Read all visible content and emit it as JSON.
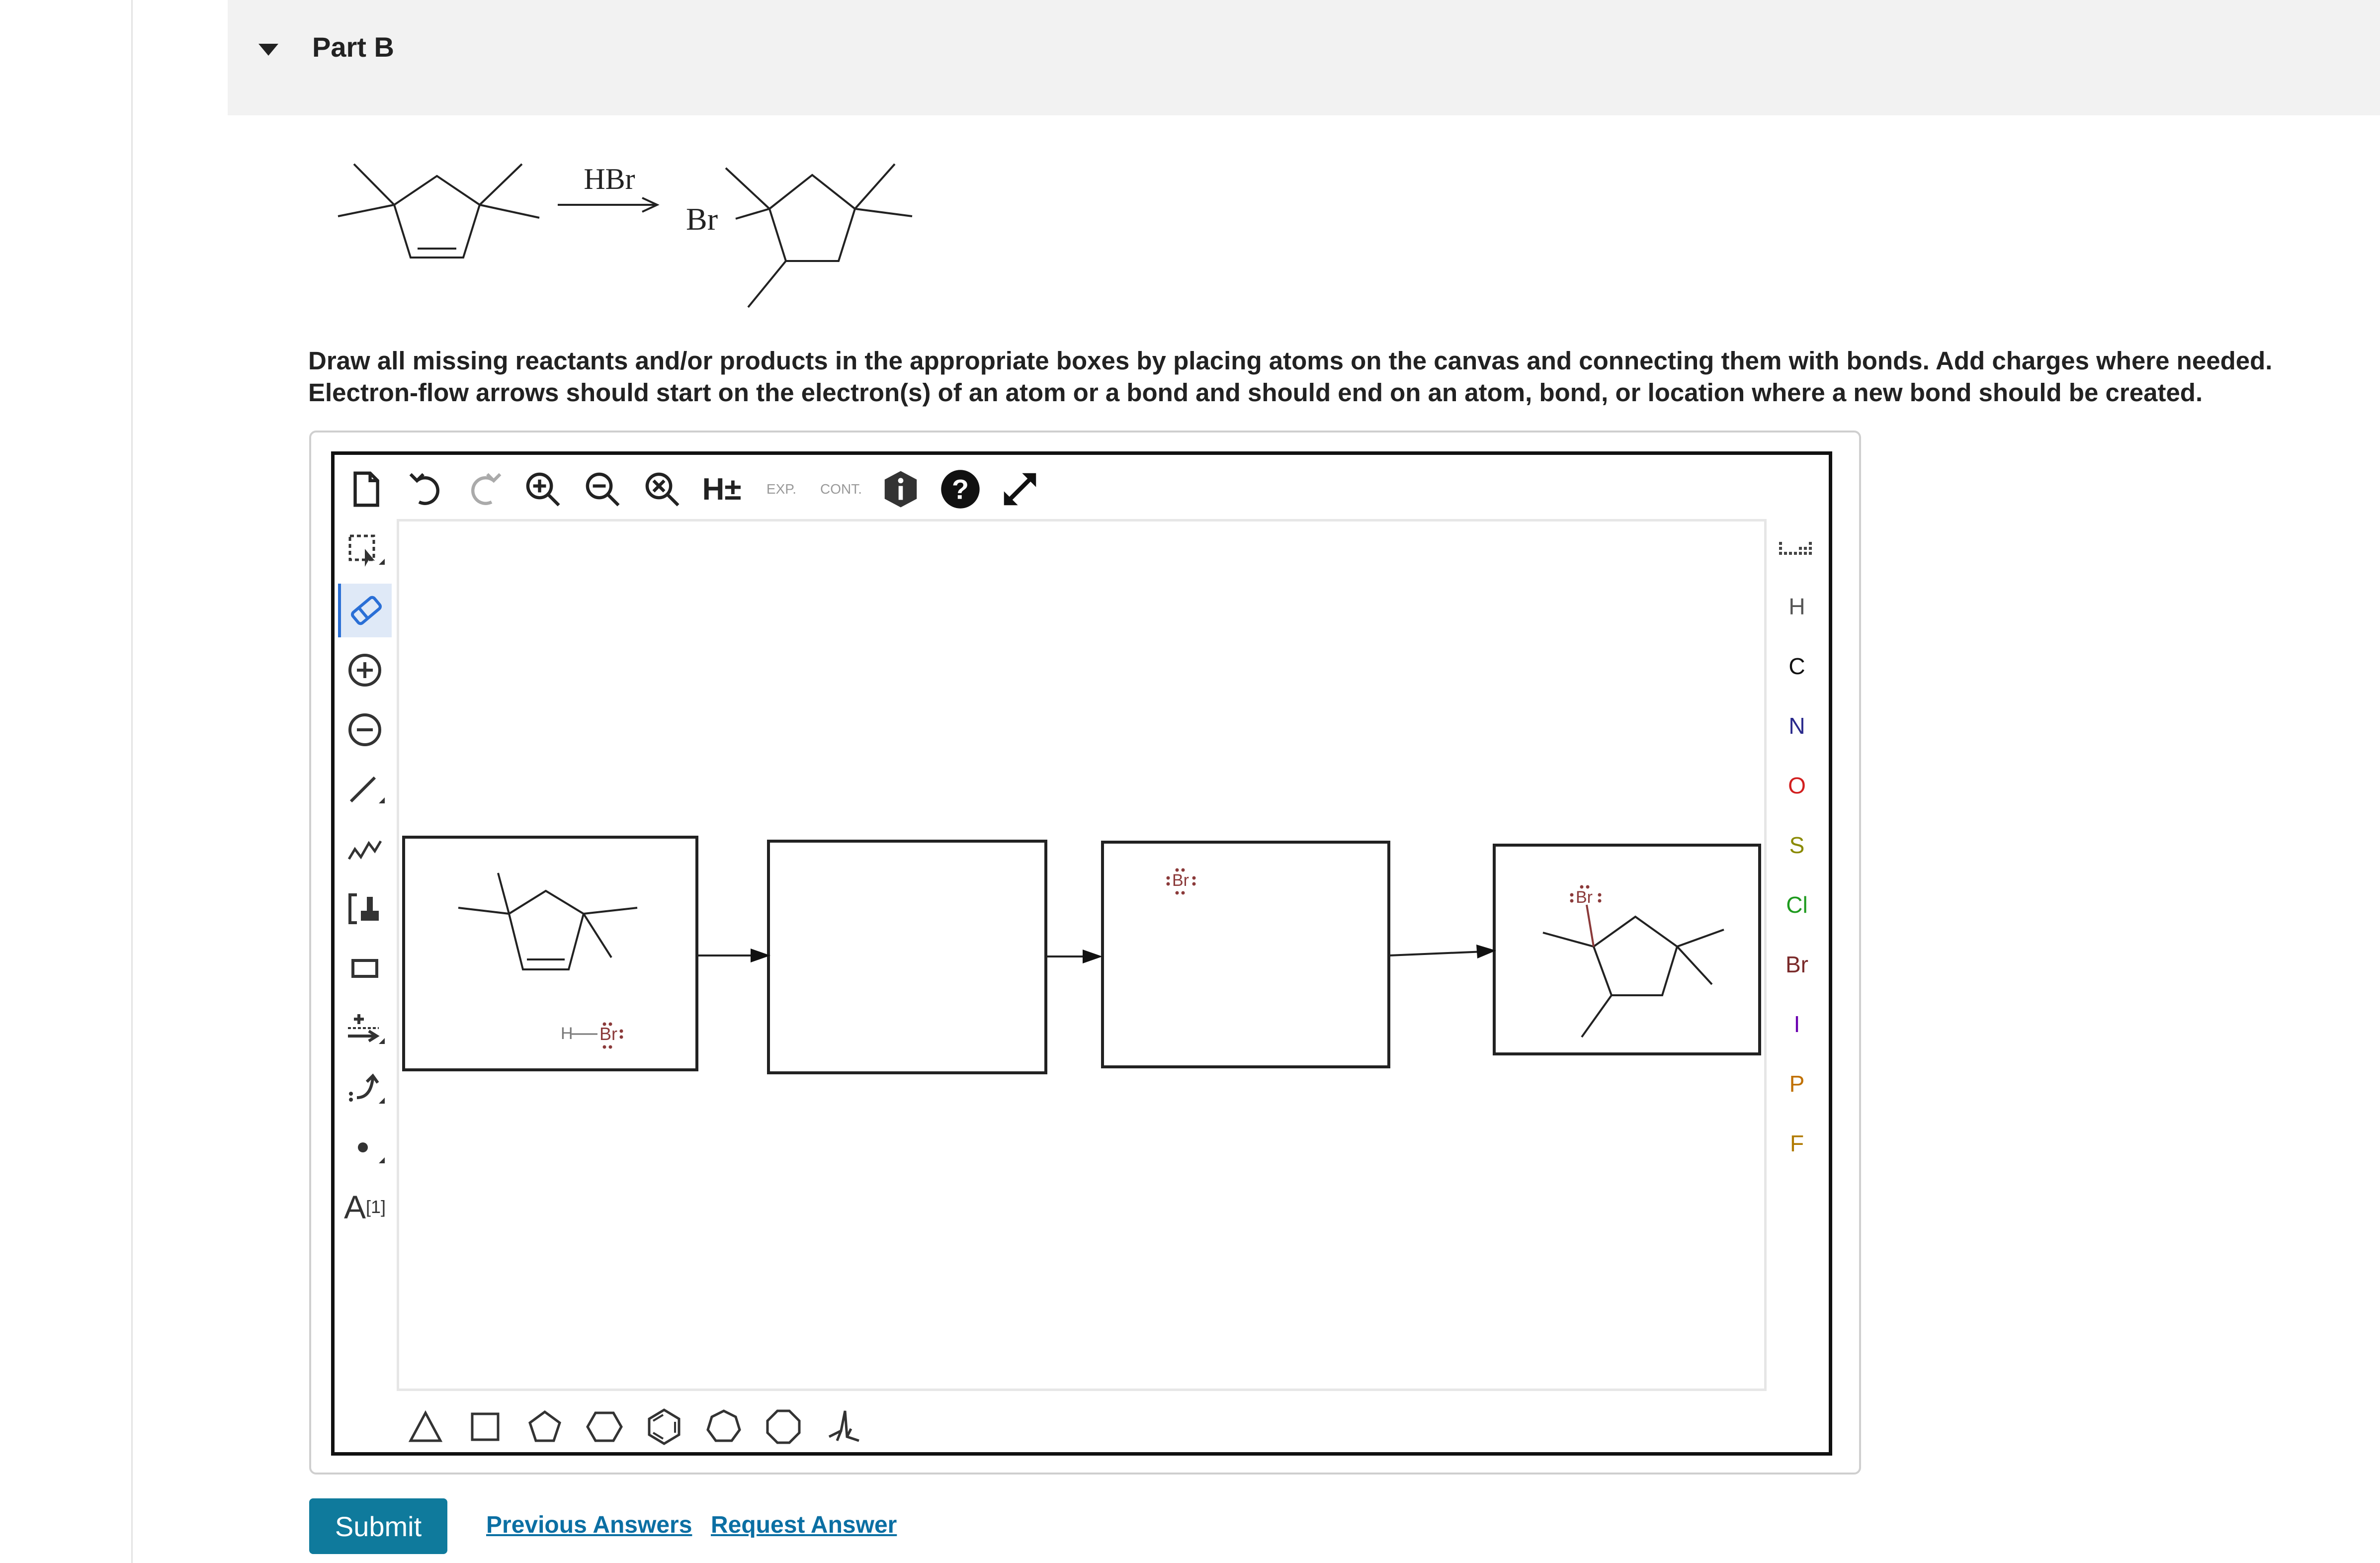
{
  "header": {
    "part_title": "Part B"
  },
  "reaction": {
    "reagent": "HBr",
    "product_label": "Br"
  },
  "instructions": {
    "line1": "Draw all missing reactants and/or products in the appropriate boxes by placing atoms on the canvas and connecting them with bonds. Add charges where needed.",
    "line2": "Electron-flow arrows should start on the electron(s) of an atom or a bond and should end on an atom, bond, or location where a new bond should be created."
  },
  "toolbar": {
    "items": [
      "new-document-icon",
      "undo-icon",
      "redo-icon",
      "zoom-in-icon",
      "zoom-out-icon",
      "zoom-reset-icon",
      "hydrogen-toggle",
      "expand-icon",
      "contract-icon",
      "info-icon",
      "help-icon",
      "fullscreen-icon"
    ],
    "h_label": "H±",
    "exp_label": "EXP.",
    "cont_label": "CONT."
  },
  "left_tools": {
    "items": [
      "select-lasso",
      "eraser",
      "positive-charge",
      "negative-charge",
      "single-bond",
      "chain",
      "bracket",
      "rectangle",
      "reaction-arrow",
      "curved-arrow",
      "radical-dot",
      "text-label"
    ],
    "active": "eraser",
    "text_label": "A",
    "text_sup": "[1]"
  },
  "elements": [
    {
      "symbol": "H",
      "color": "#555555"
    },
    {
      "symbol": "C",
      "color": "#111111"
    },
    {
      "symbol": "N",
      "color": "#2a2a8c"
    },
    {
      "symbol": "O",
      "color": "#d21f1f"
    },
    {
      "symbol": "S",
      "color": "#8a8a00"
    },
    {
      "symbol": "Cl",
      "color": "#1e9a1e"
    },
    {
      "symbol": "Br",
      "color": "#7a2a2a"
    },
    {
      "symbol": "I",
      "color": "#6b00b0"
    },
    {
      "symbol": "P",
      "color": "#c07000"
    },
    {
      "symbol": "F",
      "color": "#b07a00"
    }
  ],
  "shapes": [
    "triangle",
    "square",
    "pentagon",
    "hexagon",
    "benzene",
    "heptagon",
    "octagon",
    "chair"
  ],
  "canvas": {
    "box1": {
      "hbr_h": "H",
      "hbr_br": "Br"
    },
    "box3": {
      "br_label": "Br"
    },
    "box4": {
      "br_label": "Br"
    }
  },
  "actions": {
    "submit": "Submit",
    "previous": "Previous Answers",
    "request": "Request Answer"
  },
  "colors": {
    "accent": "#0f7a9c",
    "link": "#0b6fa3",
    "bromine": "#8b3a3a",
    "active_tool_bg": "#dfe9f7"
  }
}
